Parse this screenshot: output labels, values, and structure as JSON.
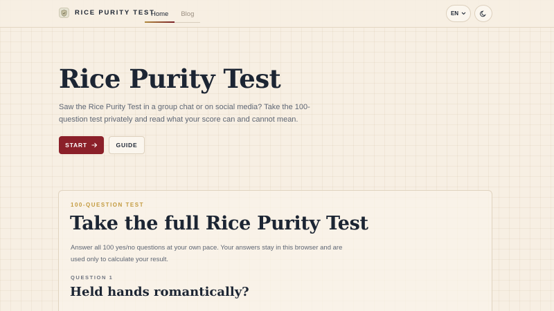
{
  "header": {
    "brand": "RICE PURITY TEST",
    "logo_icon": "shield-icon",
    "nav": [
      {
        "label": "Home",
        "active": true
      },
      {
        "label": "Blog",
        "active": false
      }
    ],
    "language": "EN",
    "theme_icon": "moon-icon"
  },
  "hero": {
    "title": "Rice Purity Test",
    "description": "Saw the Rice Purity Test in a group chat or on social media? Take the 100-question test privately and read what your score can and cannot mean.",
    "start_label": "START",
    "guide_label": "GUIDE"
  },
  "card": {
    "eyebrow": "100-QUESTION TEST",
    "title": "Take the full Rice Purity Test",
    "description": "Answer all 100 yes/no questions at your own pace. Your answers stay in this browser and are used only to calculate your result.",
    "question_label": "QUESTION 1",
    "question_text": "Held hands romantically?"
  },
  "colors": {
    "accent": "#8b2029",
    "gold": "#c39a3e",
    "ink": "#1c2533",
    "background": "#f7efe3"
  }
}
